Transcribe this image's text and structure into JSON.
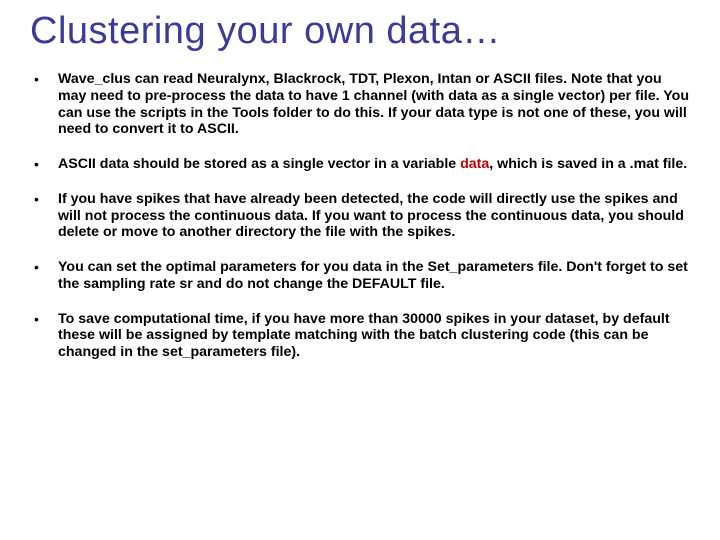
{
  "title": "Clustering your own data…",
  "bullets": [
    {
      "text": "Wave_clus can read Neuralynx, Blackrock, TDT, Plexon, Intan or ASCII files. Note that you may need to pre-process the data to have 1 channel (with data as a single vector) per file. You can use the scripts in the Tools folder to do this. If your data type is not one of these, you will need to convert it to ASCII."
    },
    {
      "pre": "ASCII data should be stored as a single vector in a variable ",
      "red": "data",
      "post": ", which is saved in a .mat file."
    },
    {
      "text": "If you have spikes that have already been detected, the code will directly use the spikes and will not process the continuous data. If you want to process the continuous data, you should delete or move to another directory the file with the spikes."
    },
    {
      "text": "You can set the optimal parameters for you data in the Set_parameters file. Don't forget to set the sampling rate sr and do not change the DEFAULT file."
    },
    {
      "text": "To save computational time, if you have more than 30000 spikes in your dataset, by default these will be assigned by template matching with the batch clustering code (this can be changed in the set_parameters file)."
    }
  ]
}
